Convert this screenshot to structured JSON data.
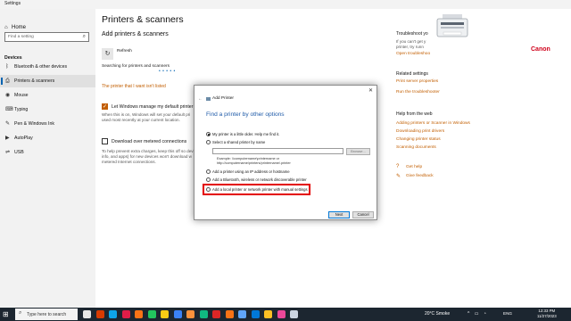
{
  "window": {
    "title": "Settings"
  },
  "sidebar": {
    "home": "Home",
    "search_placeholder": "Find a setting",
    "category": "Devices",
    "items": [
      {
        "label": "Bluetooth & other devices",
        "icon": "bluetooth-icon"
      },
      {
        "label": "Printers & scanners",
        "icon": "printer-icon",
        "selected": true
      },
      {
        "label": "Mouse",
        "icon": "mouse-icon"
      },
      {
        "label": "Typing",
        "icon": "keyboard-icon"
      },
      {
        "label": "Pen & Windows Ink",
        "icon": "pen-icon"
      },
      {
        "label": "AutoPlay",
        "icon": "autoplay-icon"
      },
      {
        "label": "USB",
        "icon": "usb-icon"
      }
    ]
  },
  "main": {
    "title": "Printers & scanners",
    "add_heading": "Add printers & scanners",
    "refresh_label": "Refresh",
    "searching": "Searching for printers and scanners",
    "progress_dots": "• • • • •",
    "not_listed_link": "The printer that I want isn't listed",
    "manage_default_label": "Let Windows manage my default printer",
    "manage_default_checked": true,
    "manage_default_desc_1": "When this is on, Windows will set your default pri",
    "manage_default_desc_2": "used most recently at your current location.",
    "metered_label": "Download over metered connections",
    "metered_checked": false,
    "metered_desc_1": "To help prevent extra charges, keep this off so devi",
    "metered_desc_2": "info, and apps) for new devices won't download w",
    "metered_desc_3": "metered Internet connections."
  },
  "right_column": {
    "troubleshoot_head": "Troubleshoot yo",
    "troubleshoot_text_1": "If you can't get y",
    "troubleshoot_text_2": "printer, try runn",
    "troubleshoot_link": "Open troubleshoo",
    "brand": "Canon",
    "related_head": "Related settings",
    "related_links": [
      "Print server properties",
      "Run the troubleshooter"
    ],
    "help_head": "Help from the web",
    "help_links": [
      "Adding printers or Scanner in Windows",
      "Downloading print drivers",
      "Changing printer status",
      "Scanning documents"
    ],
    "get_help": "Get help",
    "give_feedback": "Give feedback"
  },
  "dialog": {
    "title": "Add Printer",
    "heading": "Find a printer by other options",
    "options": [
      {
        "label": "My printer is a little older. Help me find it.",
        "selected": true
      },
      {
        "label": "Select a shared printer by name",
        "selected": false
      },
      {
        "label": "Add a printer using an IP address or hostname",
        "selected": false
      },
      {
        "label": "Add a Bluetooth, wireless or network discoverable printer",
        "selected": false
      },
      {
        "label": "Add a local printer or network printer with manual settings",
        "selected": false
      }
    ],
    "browse_label": "Browse...",
    "example_1": "Example: \\\\computername\\printername or",
    "example_2": "http://computername/printers/printername/.printer",
    "next_label": "Next",
    "cancel_label": "Cancel",
    "highlight_color": "#e30000"
  },
  "taskbar": {
    "search_placeholder": "Type here to search",
    "weather": "20°C  Smoke",
    "lang": "ENG",
    "time": "12:33 PM",
    "date": "11/27/2023",
    "apps": [
      {
        "name": "cortana-icon",
        "color": "#e8e8e8"
      },
      {
        "name": "office-icon",
        "color": "#d83b01"
      },
      {
        "name": "edge-icon",
        "color": "#0ea5e9"
      },
      {
        "name": "opera-icon",
        "color": "#e11d48"
      },
      {
        "name": "firefox-icon",
        "color": "#f97316"
      },
      {
        "name": "chrome-icon",
        "color": "#22c55e"
      },
      {
        "name": "files-icon",
        "color": "#facc15"
      },
      {
        "name": "store-icon",
        "color": "#3b82f6"
      },
      {
        "name": "vlc-icon",
        "color": "#fb923c"
      },
      {
        "name": "maps-icon",
        "color": "#10b981"
      },
      {
        "name": "acrobat-icon",
        "color": "#dc2626"
      },
      {
        "name": "brave-icon",
        "color": "#f97316"
      },
      {
        "name": "photos-icon",
        "color": "#60a5fa"
      },
      {
        "name": "mail-icon",
        "color": "#0078d7"
      },
      {
        "name": "explorer-icon",
        "color": "#fbbf24"
      },
      {
        "name": "notes-icon",
        "color": "#ec4899"
      },
      {
        "name": "settings-icon",
        "color": "#cbd5e1"
      }
    ]
  }
}
